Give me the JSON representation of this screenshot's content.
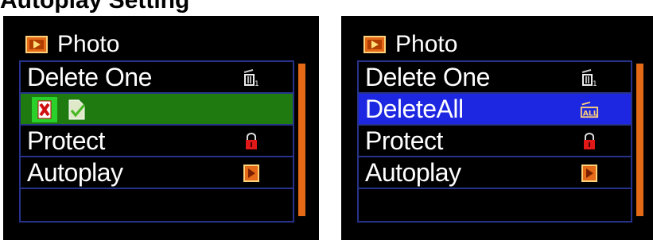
{
  "caption": {
    "text": "Autoplay Setting"
  },
  "colors": {
    "accent_orange": "#e46a18",
    "highlight_green": "#1f7a10",
    "highlight_blue": "#1d26e0",
    "border_blue": "#27338a"
  },
  "screens": [
    {
      "title": "Photo",
      "title_icon": "photo-play-icon",
      "items": [
        {
          "label": "Delete One",
          "icon": "trash-one-icon"
        },
        {
          "label": "",
          "icon": "delete-x-icon",
          "selected": true
        },
        {
          "label": "Protect",
          "icon": "lock-icon"
        },
        {
          "label": "Autoplay",
          "icon": "play-icon"
        }
      ]
    },
    {
      "title": "Photo",
      "title_icon": "photo-play-icon",
      "items": [
        {
          "label": "Delete One",
          "icon": "trash-one-icon"
        },
        {
          "label": "DeleteAll",
          "icon": "trash-all-icon",
          "selected": true
        },
        {
          "label": "Protect",
          "icon": "lock-icon"
        },
        {
          "label": "Autoplay",
          "icon": "play-icon"
        }
      ]
    }
  ]
}
